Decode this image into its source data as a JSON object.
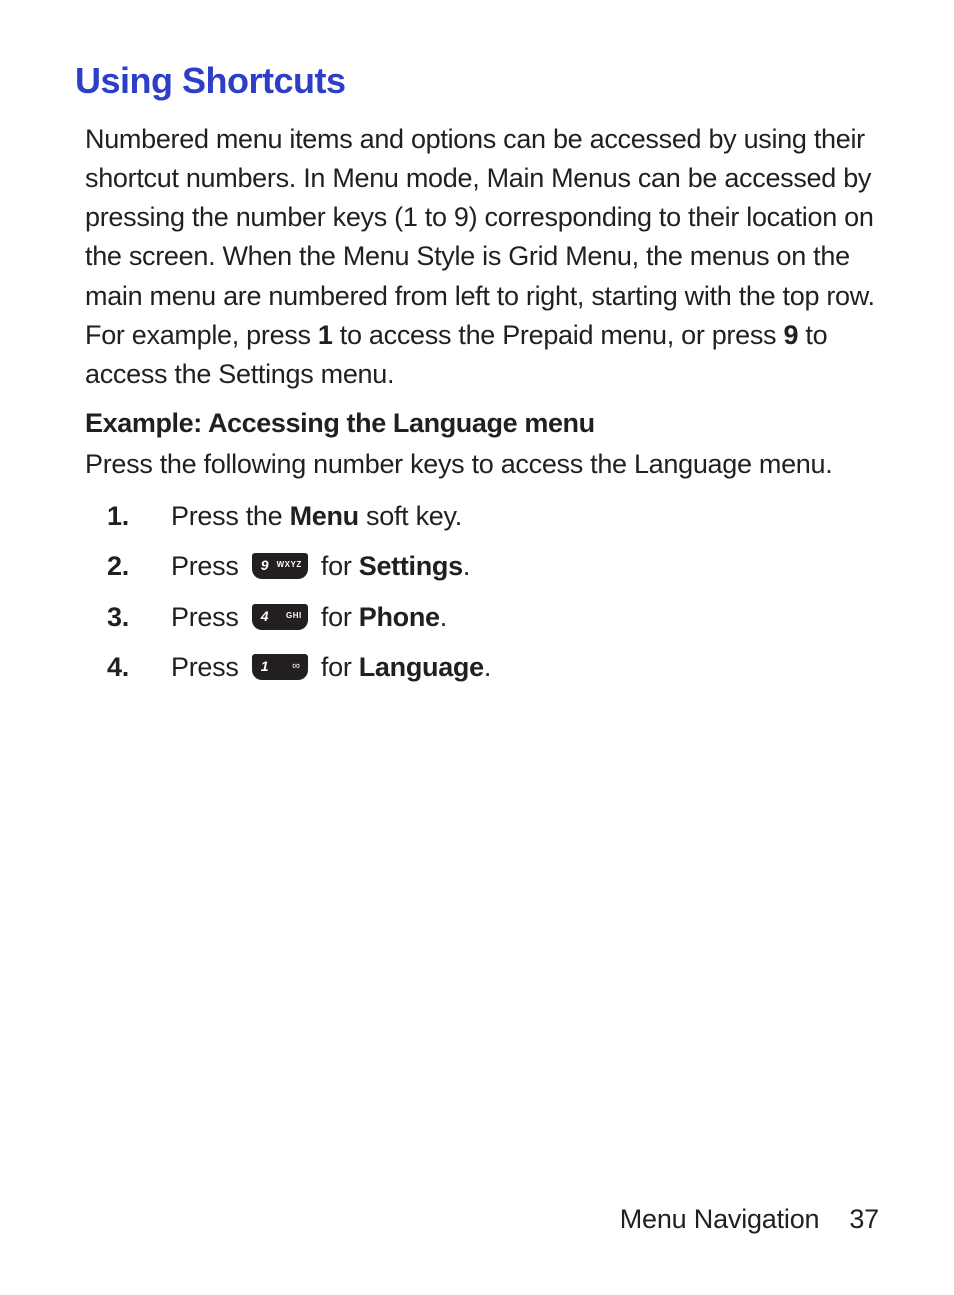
{
  "heading": "Using Shortcuts",
  "intro": {
    "pre1": "Numbered menu items and options can be accessed by using their shortcut numbers. In Menu mode, Main Menus can be accessed by pressing the number keys (1 to 9) corresponding to their location on the screen. When the Menu Style is Grid Menu, the menus on the main menu are numbered from left to right, starting with the top row. For example, press ",
    "bold1": "1",
    "mid1": " to access the Prepaid menu, or press ",
    "bold2": "9",
    "post1": " to access the Settings menu."
  },
  "subheading": "Example: Accessing the Language menu",
  "instruction": "Press the following number keys to access the Language menu.",
  "steps": [
    {
      "pre": "Press the ",
      "bold": "Menu",
      "post": " soft key."
    },
    {
      "pre": "Press ",
      "key": {
        "num": "9",
        "letters": "WXYZ"
      },
      "mid": " for ",
      "bold": "Settings",
      "post": "."
    },
    {
      "pre": "Press ",
      "key": {
        "num": "4",
        "letters": "GHI"
      },
      "mid": " for ",
      "bold": "Phone",
      "post": "."
    },
    {
      "pre": "Press ",
      "key": {
        "num": "1",
        "sym": "∞"
      },
      "mid": " for ",
      "bold": "Language",
      "post": "."
    }
  ],
  "footer": {
    "section": "Menu Navigation",
    "page": "37"
  }
}
